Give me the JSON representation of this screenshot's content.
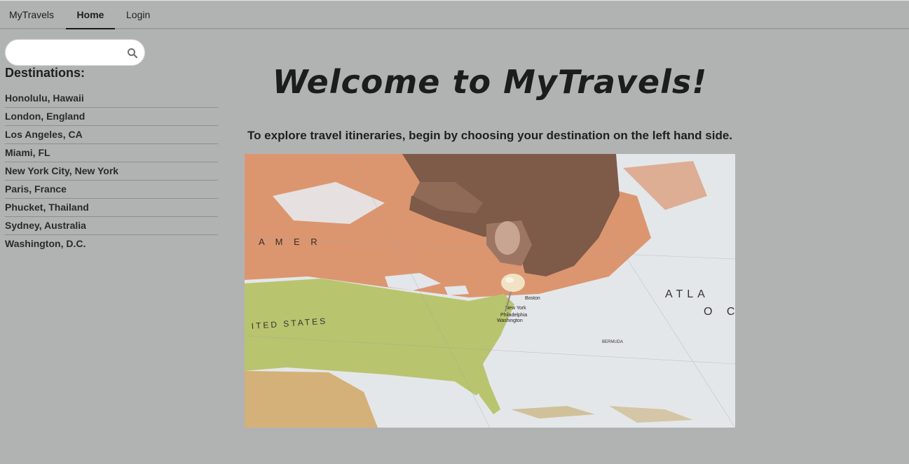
{
  "nav": {
    "brand": "MyTravels",
    "home": "Home",
    "login": "Login"
  },
  "search": {
    "value": "",
    "placeholder": "",
    "icon": "search-icon"
  },
  "sidebar": {
    "heading": "Destinations:",
    "items": [
      "Honolulu, Hawaii",
      "London, England",
      "Los Angeles, CA",
      "Miami, FL",
      "New York City, New York",
      "Paris, France",
      "Phucket, Thailand",
      "Sydney, Australia",
      "Washington, D.C."
    ]
  },
  "main": {
    "title": "Welcome to MyTravels!",
    "subtitle": "To explore travel itineraries, begin by choosing your destination on the left hand side.",
    "map_labels": {
      "ameri": "A M E R",
      "united_states": "ITED STATES",
      "atla": "ATLA",
      "oc": "O C",
      "boston": "Boston",
      "new_york": "New York",
      "philadelphia": "Philadelphia",
      "washington": "Washington",
      "bermuda": "BERMUDA"
    }
  },
  "colors": {
    "background": "#b1b3b2",
    "land_green": "#b9c46e",
    "land_orange": "#d9875a",
    "ocean": "#e3e6ea",
    "text": "#1f1f1f"
  }
}
